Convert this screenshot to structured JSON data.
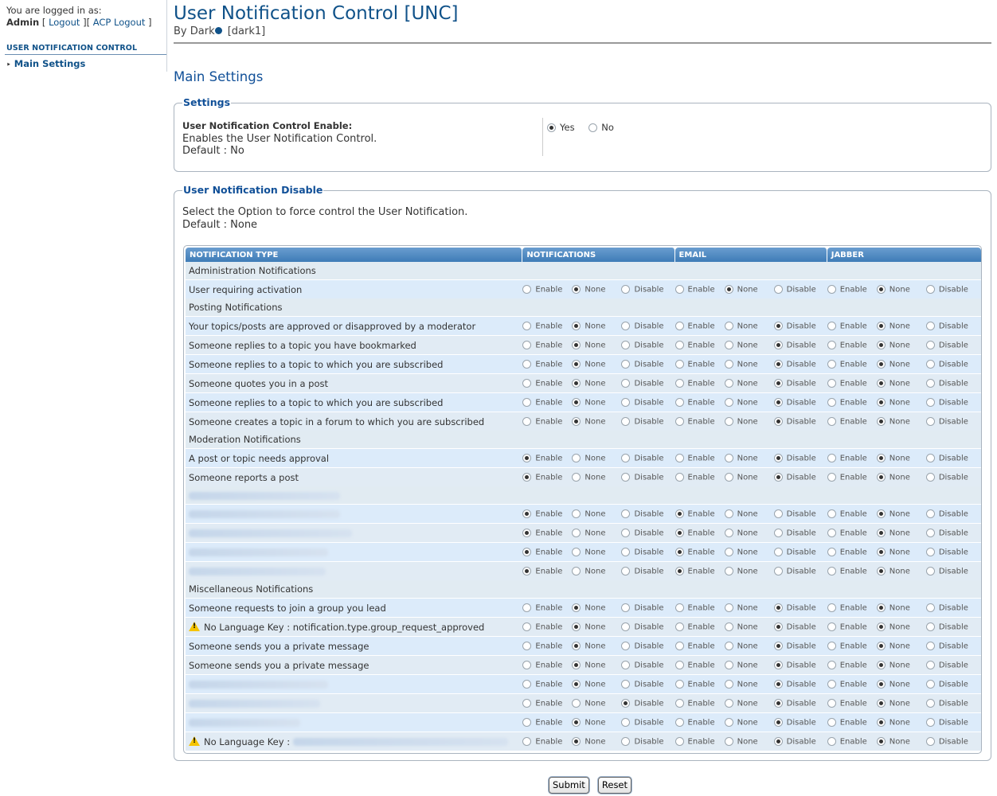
{
  "sidebar": {
    "logged_in_text": "You are logged in as:",
    "user": "Admin",
    "logout": "Logout",
    "acp_logout": "ACP Logout",
    "section": "USER NOTIFICATION CONTROL",
    "link": "Main Settings"
  },
  "header": {
    "title": "User Notification Control [UNC]",
    "by": "By Dark",
    "author_tag": "[dark1]",
    "section_title": "Main Settings"
  },
  "settings": {
    "legend": "Settings",
    "label": "User Notification Control Enable:",
    "desc": "Enables the User Notification Control.",
    "default": "Default : No",
    "yes": "Yes",
    "no": "No",
    "selected": "Yes"
  },
  "unc": {
    "legend": "User Notification Disable",
    "desc": "Select the Option to force control the User Notification.",
    "default": "Default : None",
    "columns": [
      "NOTIFICATION TYPE",
      "NOTIFICATIONS",
      "EMAIL",
      "JABBER"
    ],
    "option_labels": [
      "Enable",
      "None",
      "Disable"
    ],
    "rows": [
      {
        "type": "header",
        "label": "Administration Notifications"
      },
      {
        "type": "row",
        "label": "User requiring activation",
        "sel": [
          1,
          1,
          1
        ]
      },
      {
        "type": "header",
        "label": "Posting Notifications"
      },
      {
        "type": "row",
        "label": "Your topics/posts are approved or disapproved by a moderator",
        "sel": [
          1,
          2,
          1
        ]
      },
      {
        "type": "row",
        "label": "Someone replies to a topic you have bookmarked",
        "sel": [
          1,
          2,
          1
        ]
      },
      {
        "type": "row",
        "label": "Someone replies to a topic to which you are subscribed",
        "sel": [
          1,
          2,
          1
        ]
      },
      {
        "type": "row",
        "label": "Someone quotes you in a post",
        "sel": [
          1,
          2,
          1
        ]
      },
      {
        "type": "row",
        "label": "Someone replies to a topic to which you are subscribed",
        "sel": [
          1,
          2,
          1
        ]
      },
      {
        "type": "row",
        "label": "Someone creates a topic in a forum to which you are subscribed",
        "sel": [
          1,
          2,
          1
        ]
      },
      {
        "type": "header",
        "label": "Moderation Notifications"
      },
      {
        "type": "row",
        "label": "A post or topic needs approval",
        "sel": [
          0,
          2,
          1
        ]
      },
      {
        "type": "row",
        "label": "Someone reports a post",
        "sel": [
          0,
          2,
          1
        ]
      },
      {
        "type": "header",
        "label": "",
        "blurred": true,
        "blur_w": 190
      },
      {
        "type": "row",
        "label": "",
        "blurred": true,
        "blur_w": 190,
        "sel": [
          0,
          0,
          1
        ]
      },
      {
        "type": "row",
        "label": "",
        "blurred": true,
        "blur_w": 205,
        "sel": [
          0,
          0,
          1
        ]
      },
      {
        "type": "row",
        "label": "",
        "blurred": true,
        "blur_w": 175,
        "sel": [
          0,
          0,
          1
        ]
      },
      {
        "type": "row",
        "label": "",
        "blurred": true,
        "blur_w": 172,
        "sel": [
          0,
          0,
          1
        ]
      },
      {
        "type": "header",
        "label": "Miscellaneous Notifications"
      },
      {
        "type": "row",
        "label": "Someone requests to join a group you lead",
        "sel": [
          1,
          2,
          1
        ]
      },
      {
        "type": "row",
        "label": "No Language Key : notification.type.group_request_approved",
        "warn": true,
        "sel": [
          1,
          2,
          1
        ]
      },
      {
        "type": "row",
        "label": "Someone sends you a private message",
        "sel": [
          1,
          2,
          1
        ]
      },
      {
        "type": "row",
        "label": "Someone sends you a private message",
        "sel": [
          1,
          2,
          1
        ]
      },
      {
        "type": "row",
        "label": "",
        "blurred": true,
        "blur_w": 175,
        "sel": [
          1,
          2,
          1
        ]
      },
      {
        "type": "row",
        "label": "",
        "blurred": true,
        "blur_w": 165,
        "sel": [
          2,
          2,
          1
        ]
      },
      {
        "type": "row",
        "label": "",
        "blurred": true,
        "blur_w": 140,
        "sel": [
          1,
          2,
          1
        ]
      },
      {
        "type": "row",
        "label": "No Language Key :",
        "warn": true,
        "blur_after": 270,
        "sel": [
          1,
          2,
          1
        ]
      }
    ]
  },
  "buttons": {
    "submit": "Submit",
    "reset": "Reset"
  }
}
